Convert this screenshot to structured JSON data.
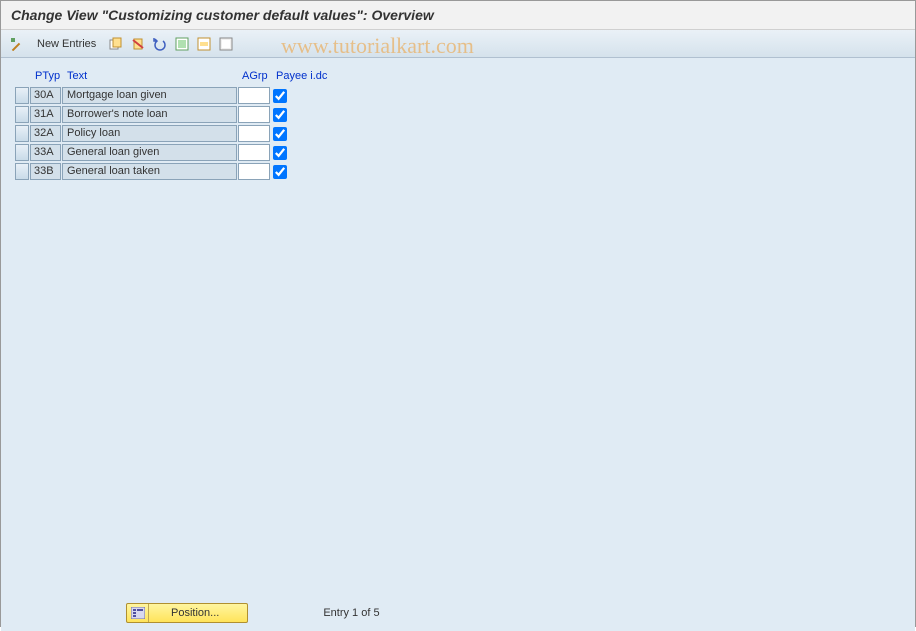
{
  "title": "Change View \"Customizing customer default values\": Overview",
  "toolbar": {
    "new_entries_label": "New Entries"
  },
  "watermark": "www.tutorialkart.com",
  "table": {
    "headers": {
      "ptyp": "PTyp",
      "text": "Text",
      "agrp": "AGrp",
      "payee": "Payee i.dc"
    },
    "rows": [
      {
        "ptyp": "30A",
        "text": "Mortgage loan given",
        "agrp": "",
        "payee": true
      },
      {
        "ptyp": "31A",
        "text": "Borrower's note loan",
        "agrp": "",
        "payee": true
      },
      {
        "ptyp": "32A",
        "text": "Policy loan",
        "agrp": "",
        "payee": true
      },
      {
        "ptyp": "33A",
        "text": "General loan given",
        "agrp": "",
        "payee": true
      },
      {
        "ptyp": "33B",
        "text": "General loan taken",
        "agrp": "",
        "payee": true
      }
    ]
  },
  "footer": {
    "position_label": "Position...",
    "entry_status": "Entry 1 of 5"
  }
}
